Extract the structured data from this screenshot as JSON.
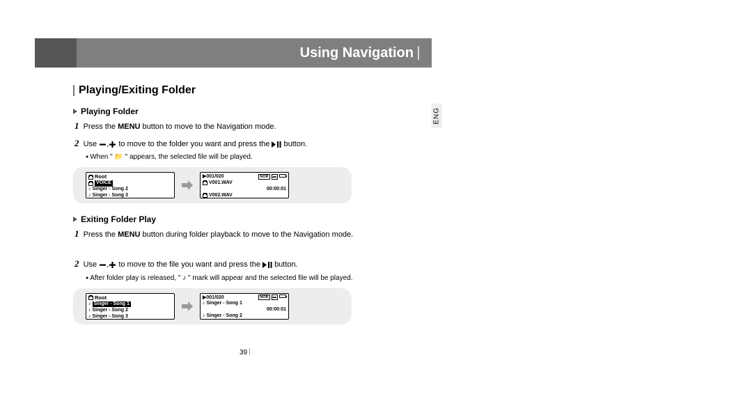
{
  "header": {
    "title": "Using Navigation"
  },
  "section_title": "Playing/Exiting Folder",
  "lang": "ENG",
  "playing": {
    "heading": "Playing Folder",
    "step1_pre": "Press the ",
    "step1_bold": "MENU",
    "step1_post": " button to move to the Navigation mode.",
    "step2_pre": "Use ",
    "step2_mid": " to move to the folder you want and press the ",
    "step2_post": " button.",
    "note": "When \" 📁 \" appears, the selected file will be played."
  },
  "screens1": {
    "left": {
      "root": "Root",
      "hl": "VOICE",
      "r2": "Singer - Song 2",
      "r3": "Singer - Song 3"
    },
    "right": {
      "counter": "001/020",
      "f1": "V001.WAV",
      "time": "00:00:01",
      "f2": "V002.WAV"
    }
  },
  "exiting": {
    "heading": "Exiting Folder Play",
    "step1_pre": "Press the ",
    "step1_bold": "MENU",
    "step1_post": " button during folder playback to move to the Navigation mode.",
    "step2_pre": "Use ",
    "step2_mid": " to move to the file you want and press the ",
    "step2_post": " button.",
    "note": "After folder play is released, \" ♪ \" mark will appear and the selected file will be played."
  },
  "screens2": {
    "left": {
      "root": "Root",
      "hl": "Singer - Song 1",
      "r2": "Singer - Song 2",
      "r3": "Singer - Song 3"
    },
    "right": {
      "counter": "001/020",
      "f1": "Singer - Song 1",
      "time": "00:00:01",
      "f2": "Singer - Song 2"
    }
  },
  "page_number": "39"
}
